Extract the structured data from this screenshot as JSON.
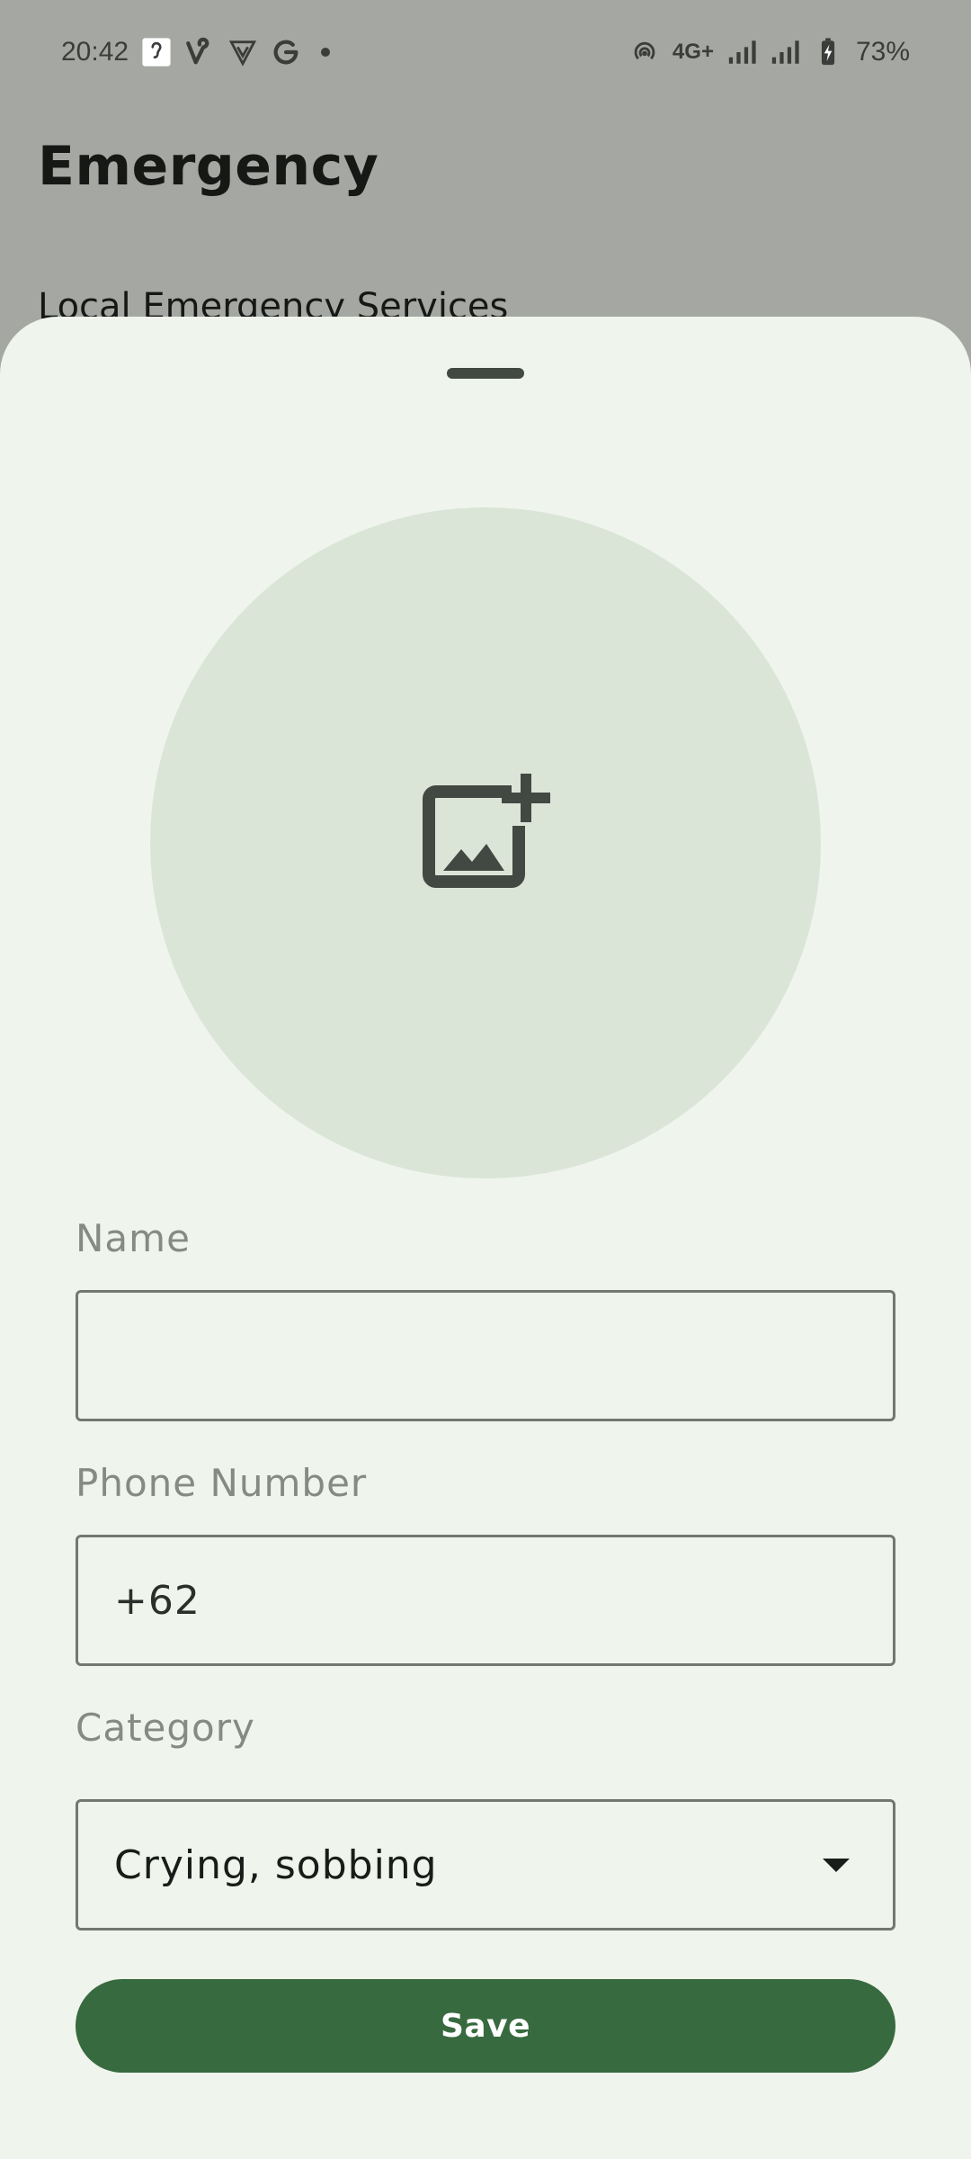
{
  "status_bar": {
    "time": "20:42",
    "network_label": "4G+",
    "battery_percent": "73%",
    "left_icons": [
      "hearing-icon",
      "vine-icon",
      "shield-v-icon",
      "google-icon"
    ],
    "right_icons": [
      "hotspot-icon",
      "signal-icon",
      "signal-icon-2",
      "battery-charging-icon"
    ]
  },
  "background_page": {
    "title": "Emergency",
    "subtitle": "Local Emergency Services"
  },
  "sheet": {
    "photo_icon": "add-photo-icon",
    "name": {
      "label": "Name",
      "value": ""
    },
    "phone": {
      "label": "Phone Number",
      "value": "+62"
    },
    "category": {
      "label": "Category",
      "selected": "Crying, sobbing"
    },
    "save_label": "Save"
  },
  "colors": {
    "scrim": "#a5a7a2",
    "sheet_bg": "#eff4ec",
    "photo_circle": "#dae5d8",
    "primary": "#386a3f",
    "icon_dark": "#414942"
  }
}
